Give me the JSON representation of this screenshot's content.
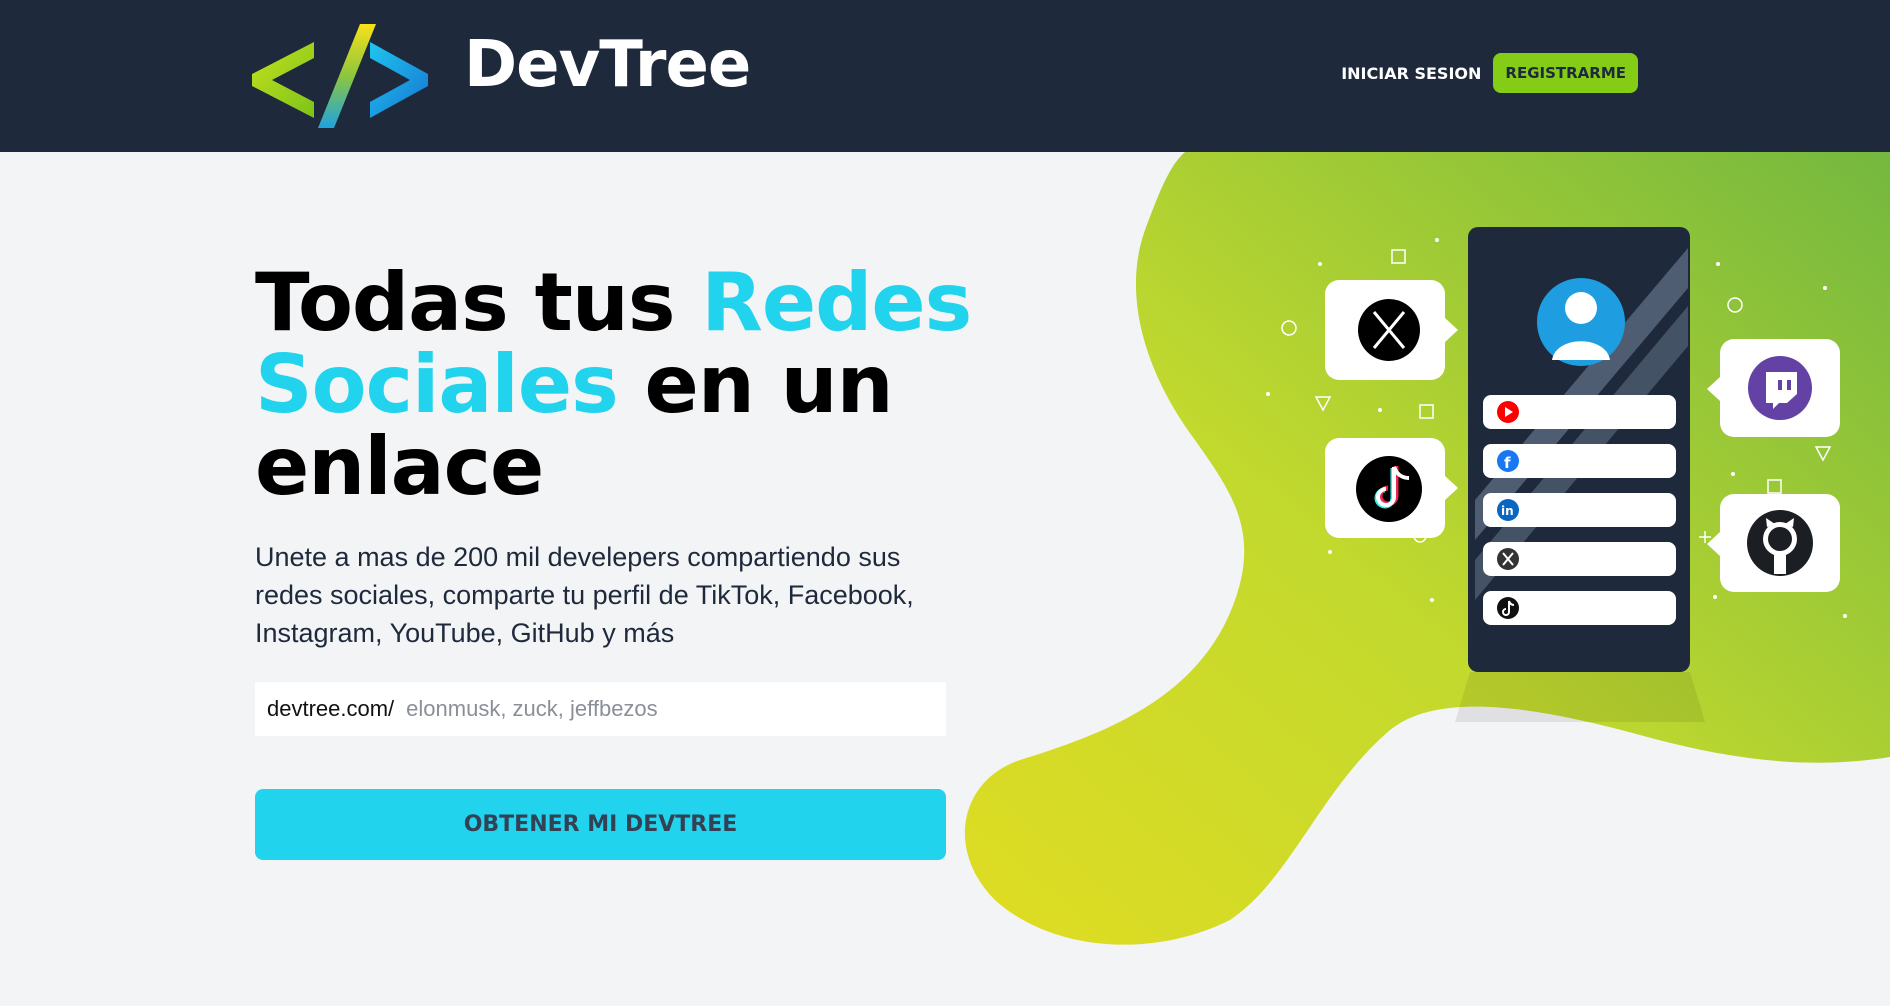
{
  "header": {
    "brand": "DevTree",
    "logo_icon": "code-brackets-icon",
    "login_label": "INICIAR SESION",
    "register_label": "REGISTRARME"
  },
  "hero": {
    "headline_part1": "Todas tus ",
    "headline_accent": "Redes Sociales",
    "headline_part2": " en un enlace",
    "subtitle": "Unete a mas de 200 mil develepers compartiendo sus redes sociales, comparte tu perfil de TikTok, Facebook, Instagram, YouTube, GitHub y más",
    "prefix": "devtree.com/",
    "placeholder": "elonmusk, zuck, jeffbezos",
    "cta_label": "OBTENER MI DEVTREE"
  },
  "illustration": {
    "phone_links": [
      "youtube-icon",
      "facebook-icon",
      "linkedin-icon",
      "x-icon",
      "tiktok-icon"
    ],
    "bubbles": [
      "x-icon",
      "tiktok-icon",
      "twitch-icon",
      "github-icon"
    ]
  },
  "colors": {
    "header_bg": "#1e293b",
    "accent_cyan": "#22d3ee",
    "accent_lime": "#84cc16",
    "page_bg": "#f3f4f6"
  }
}
